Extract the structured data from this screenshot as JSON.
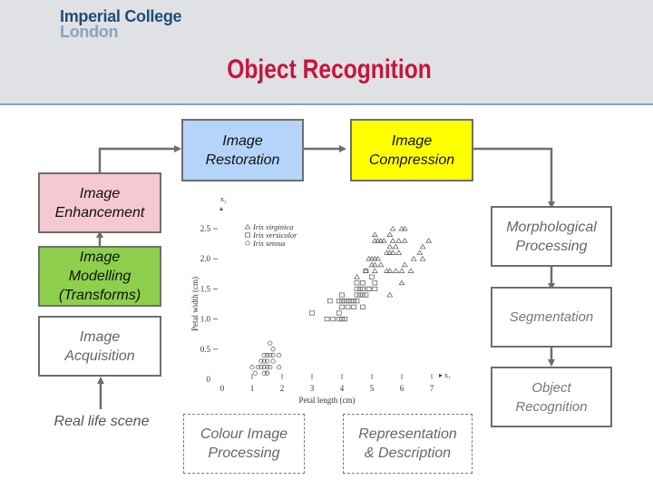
{
  "header": {
    "logo_line1": "Imperial College",
    "logo_line2": "London",
    "title": "Object Recognition"
  },
  "colors": {
    "title": "#c8143c",
    "restoration_fill": "#b4d4fa",
    "compression_fill": "#ffff00",
    "enhancement_fill": "#f5c9d2",
    "modelling_fill": "#8ecf4c",
    "box_border": "#6e6e6e"
  },
  "boxes": {
    "restoration": [
      "Image",
      "Restoration"
    ],
    "compression": [
      "Image",
      "Compression"
    ],
    "enhancement": [
      "Image",
      "Enhancement"
    ],
    "modelling": [
      "Image",
      "Modelling",
      "(Transforms)"
    ],
    "acquisition": [
      "Image",
      "Acquisition"
    ],
    "morphological": [
      "Morphological",
      "Processing"
    ],
    "segmentation": [
      "Segmentation"
    ],
    "object_recognition": [
      "Object",
      "Recognition"
    ],
    "colour": [
      "Colour Image",
      "Processing"
    ],
    "representation": [
      "Representation",
      "& Description"
    ]
  },
  "real_life_scene": "Real life scene",
  "chart_data": {
    "type": "scatter",
    "title": "",
    "xlabel": "Petal length (cm)",
    "ylabel": "Petal width (cm)",
    "x_axis_name": "x1",
    "y_axis_name": "x2",
    "xlim": [
      0,
      7
    ],
    "ylim": [
      0,
      2.5
    ],
    "xticks": [
      "0",
      "1",
      "2",
      "3",
      "4",
      "5",
      "6",
      "7"
    ],
    "yticks": [
      "0",
      "0.5",
      "1.0",
      "1.5",
      "2.0",
      "2.5"
    ],
    "grid": false,
    "legend_position": "top-left",
    "series": [
      {
        "name": "Iris virginica",
        "marker": "triangle",
        "points": [
          [
            5.7,
            2.5
          ],
          [
            6.0,
            2.5
          ],
          [
            6.1,
            2.5
          ],
          [
            5.6,
            2.4
          ],
          [
            5.1,
            2.3
          ],
          [
            5.2,
            2.3
          ],
          [
            5.3,
            2.3
          ],
          [
            5.4,
            2.3
          ],
          [
            5.7,
            2.3
          ],
          [
            5.9,
            2.3
          ],
          [
            6.1,
            2.3
          ],
          [
            6.9,
            2.3
          ],
          [
            5.6,
            2.2
          ],
          [
            5.8,
            2.2
          ],
          [
            6.7,
            2.2
          ],
          [
            5.5,
            2.1
          ],
          [
            5.6,
            2.1
          ],
          [
            5.7,
            2.1
          ],
          [
            5.9,
            2.1
          ],
          [
            6.6,
            2.1
          ],
          [
            4.9,
            2.0
          ],
          [
            5.0,
            2.0
          ],
          [
            5.1,
            2.0
          ],
          [
            6.4,
            2.0
          ],
          [
            6.7,
            2.0
          ],
          [
            5.0,
            1.9
          ],
          [
            5.1,
            1.9
          ],
          [
            5.3,
            1.9
          ],
          [
            6.1,
            1.9
          ],
          [
            4.8,
            1.8
          ],
          [
            5.1,
            1.8
          ],
          [
            5.5,
            1.8
          ],
          [
            5.8,
            1.8
          ],
          [
            6.3,
            1.8
          ],
          [
            4.5,
            1.7
          ],
          [
            6.0,
            1.6
          ],
          [
            5.6,
            1.4
          ],
          [
            5.1,
            2.4
          ],
          [
            5.2,
            2.0
          ],
          [
            5.6,
            1.8
          ],
          [
            6.0,
            1.8
          ]
        ]
      },
      {
        "name": "Iris versicolor",
        "marker": "square",
        "points": [
          [
            4.5,
            1.6
          ],
          [
            4.7,
            1.6
          ],
          [
            5.1,
            1.6
          ],
          [
            4.5,
            1.5
          ],
          [
            4.6,
            1.5
          ],
          [
            4.9,
            1.5
          ],
          [
            5.0,
            1.7
          ],
          [
            4.5,
            1.4
          ],
          [
            4.6,
            1.4
          ],
          [
            4.7,
            1.4
          ],
          [
            4.8,
            1.4
          ],
          [
            4.9,
            1.5
          ],
          [
            3.6,
            1.3
          ],
          [
            3.9,
            1.3
          ],
          [
            4.0,
            1.3
          ],
          [
            4.1,
            1.3
          ],
          [
            4.2,
            1.3
          ],
          [
            4.3,
            1.3
          ],
          [
            4.4,
            1.3
          ],
          [
            4.5,
            1.3
          ],
          [
            4.0,
            1.2
          ],
          [
            4.2,
            1.2
          ],
          [
            4.4,
            1.2
          ],
          [
            4.7,
            1.2
          ],
          [
            3.0,
            1.1
          ],
          [
            3.9,
            1.1
          ],
          [
            3.5,
            1.0
          ],
          [
            3.7,
            1.0
          ],
          [
            3.9,
            1.0
          ],
          [
            4.0,
            1.0
          ],
          [
            4.1,
            1.0
          ],
          [
            4.7,
            1.5
          ],
          [
            4.0,
            1.4
          ],
          [
            4.8,
            1.8
          ],
          [
            5.1,
            1.5
          ]
        ]
      },
      {
        "name": "Iris setosa",
        "marker": "circle",
        "points": [
          [
            1.7,
            0.5
          ],
          [
            1.6,
            0.6
          ],
          [
            1.4,
            0.4
          ],
          [
            1.5,
            0.4
          ],
          [
            1.7,
            0.4
          ],
          [
            1.9,
            0.4
          ],
          [
            1.3,
            0.3
          ],
          [
            1.4,
            0.3
          ],
          [
            1.5,
            0.3
          ],
          [
            1.7,
            0.3
          ],
          [
            1.0,
            0.2
          ],
          [
            1.3,
            0.2
          ],
          [
            1.4,
            0.2
          ],
          [
            1.5,
            0.2
          ],
          [
            1.6,
            0.2
          ],
          [
            1.9,
            0.2
          ],
          [
            1.1,
            0.1
          ],
          [
            1.4,
            0.1
          ],
          [
            1.5,
            0.1
          ],
          [
            1.2,
            0.2
          ],
          [
            1.6,
            0.4
          ],
          [
            1.5,
            0.1
          ]
        ]
      }
    ]
  }
}
